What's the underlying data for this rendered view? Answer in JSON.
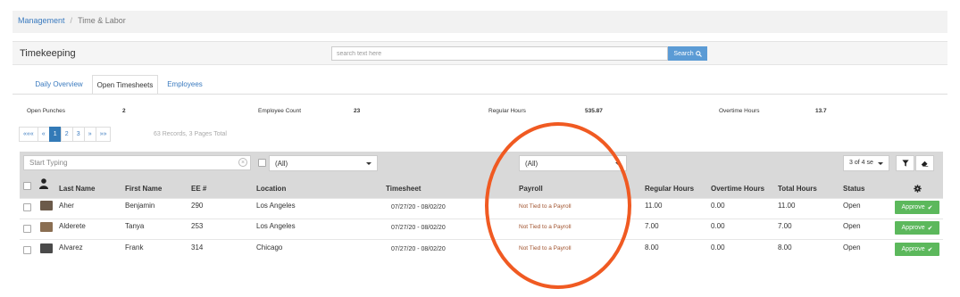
{
  "breadcrumb": {
    "root": "Management",
    "separator": "/",
    "current": "Time & Labor"
  },
  "panel": {
    "title": "Timekeeping",
    "search_placeholder": "search text here",
    "search_button": "Search"
  },
  "tabs": [
    "Daily Overview",
    "Open Timesheets",
    "Employees"
  ],
  "active_tab": "Open Timesheets",
  "summary": {
    "open_punches_label": "Open Punches",
    "open_punches": "2",
    "employee_count_label": "Employee Count",
    "employee_count": "23",
    "regular_hours_label": "Regular Hours",
    "regular_hours": "535.87",
    "overtime_hours_label": "Overtime Hours",
    "overtime_hours": "13.7"
  },
  "pager": {
    "first": "«««",
    "prev": "«",
    "pages": [
      "1",
      "2",
      "3"
    ],
    "current_page": "1",
    "next": "»",
    "last": "»»",
    "records_text": "63 Records, 3 Pages Total"
  },
  "filters": {
    "name_placeholder": "Start Typing",
    "location_select": "(All)",
    "payroll_select": "(All)",
    "columns_select": "3 of 4 se"
  },
  "columns": [
    "Last Name",
    "First Name",
    "EE #",
    "Location",
    "Timesheet",
    "Payroll",
    "Regular Hours",
    "Overtime Hours",
    "Total Hours",
    "Status"
  ],
  "rows": [
    {
      "last": "Aher",
      "first": "Benjamin",
      "ee": "290",
      "location": "Los Angeles",
      "timesheet": "07/27/20 - 08/02/20",
      "payroll": "Not Tied to a Payroll",
      "regular": "11.00",
      "overtime": "0.00",
      "total": "11.00",
      "status": "Open",
      "action": "Approve"
    },
    {
      "last": "Alderete",
      "first": "Tanya",
      "ee": "253",
      "location": "Los Angeles",
      "timesheet": "07/27/20 - 08/02/20",
      "payroll": "Not Tied to a Payroll",
      "regular": "7.00",
      "overtime": "0.00",
      "total": "7.00",
      "status": "Open",
      "action": "Approve"
    },
    {
      "last": "Alvarez",
      "first": "Frank",
      "ee": "314",
      "location": "Chicago",
      "timesheet": "07/27/20 - 08/02/20",
      "payroll": "Not Tied to a Payroll",
      "regular": "8.00",
      "overtime": "0.00",
      "total": "8.00",
      "status": "Open",
      "action": "Approve"
    }
  ],
  "colors": {
    "link": "#3a7abf",
    "primary": "#337ab7",
    "approve": "#5cb85c",
    "annotation": "#f05a22",
    "payroll_text": "#a0522d"
  },
  "icons": {
    "search": "search-icon",
    "filter": "filter-icon",
    "eraser": "eraser-icon",
    "settings": "gear-icon",
    "person": "person-icon",
    "check": "check-icon"
  }
}
